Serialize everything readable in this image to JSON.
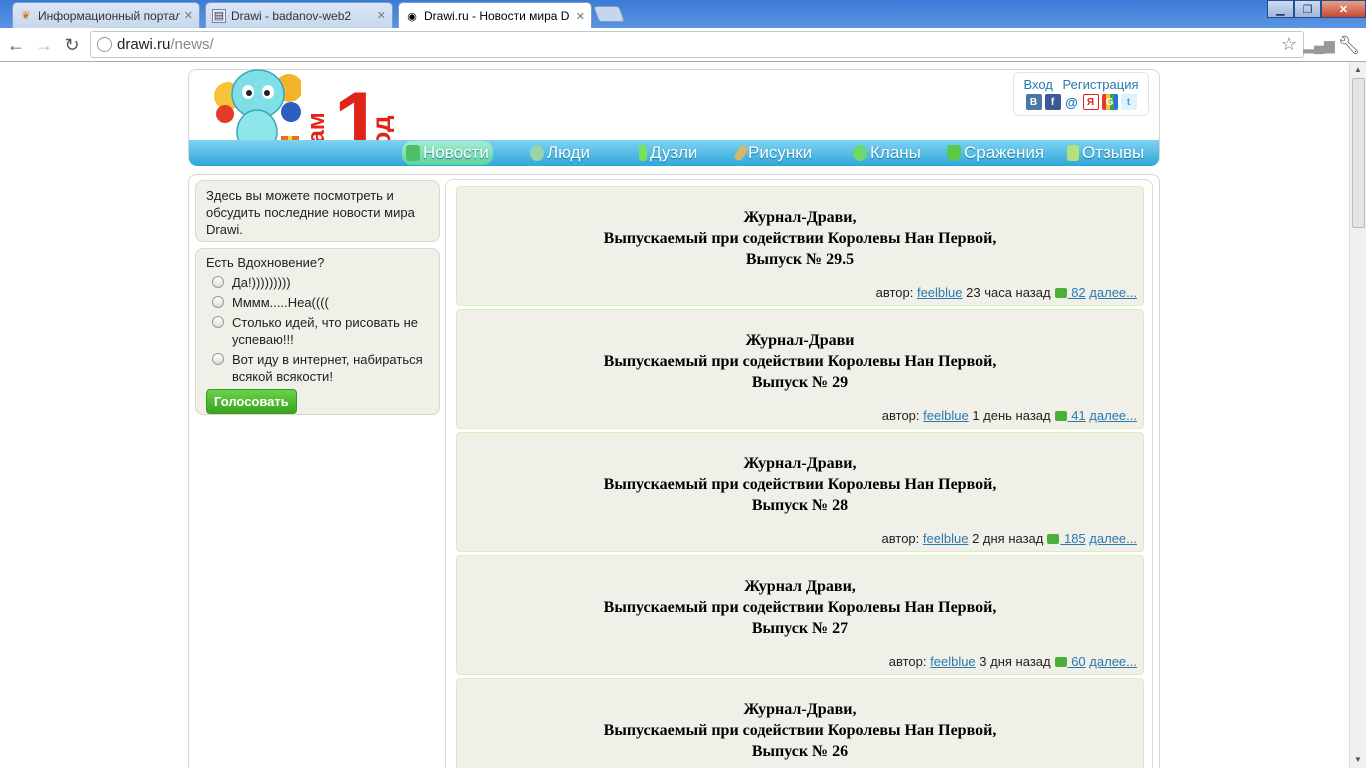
{
  "browser": {
    "tabs": [
      {
        "title": "Информационный портал",
        "favicon": "leaf-icon",
        "active": false
      },
      {
        "title": "Drawi - badanov-web2",
        "favicon": "page-icon",
        "active": false
      },
      {
        "title": "Drawi.ru - Новости мира D",
        "favicon": "eye-icon",
        "active": true
      }
    ],
    "url_host": "drawi.ru",
    "url_path": "/news/"
  },
  "header": {
    "login": "Вход",
    "register": "Регистрация",
    "socials": [
      "В",
      "f",
      "@",
      "Я",
      "G",
      "t"
    ],
    "nav": [
      {
        "label": "Новости",
        "active": true
      },
      {
        "label": "Люди",
        "active": false
      },
      {
        "label": "Дузли",
        "active": false
      },
      {
        "label": "Рисунки",
        "active": false
      },
      {
        "label": "Кланы",
        "active": false
      },
      {
        "label": "Сражения",
        "active": false
      },
      {
        "label": "Отзывы",
        "active": false
      }
    ],
    "logo_text": "нам 1 год"
  },
  "sidebar": {
    "intro": "Здесь вы можете посмотреть и обсудить последние новости мира Drawi.",
    "poll": {
      "question": "Есть Вдохновение?",
      "options": [
        "Да!)))))))))",
        "Мммм.....Неа((((",
        "Столько идей, что рисовать не успеваю!!!",
        "Вот иду в интернет, набираться всякой всякости!"
      ],
      "vote_label": "Голосовать"
    }
  },
  "news": [
    {
      "line1": "Журнал-Драви,",
      "line2": "Выпускаемый при содействии Королевы Нан Первой,",
      "line3": "Выпуск № 29.5",
      "author_label": "автор:",
      "author": "feelblue",
      "time": "23 часа назад",
      "comments": " 82",
      "more": "далее..."
    },
    {
      "line1": "Журнал-Драви",
      "line2": "Выпускаемый при содействии Королевы Нан Первой,",
      "line3": "Выпуск № 29",
      "author_label": "автор:",
      "author": "feelblue",
      "time": "1 день назад",
      "comments": " 41",
      "more": "далее..."
    },
    {
      "line1": "Журнал-Драви,",
      "line2": "Выпускаемый при содействии Королевы Нан Первой,",
      "line3": "Выпуск № 28",
      "author_label": "автор:",
      "author": "feelblue",
      "time": "2 дня назад",
      "comments": " 185",
      "more": "далее..."
    },
    {
      "line1": "Журнал Драви,",
      "line2": "Выпускаемый при содействии Королевы Нан Первой,",
      "line3": "Выпуск № 27",
      "author_label": "автор:",
      "author": "feelblue",
      "time": "3 дня назад",
      "comments": " 60",
      "more": "далее..."
    },
    {
      "line1": "Журнал-Драви,",
      "line2": "Выпускаемый при содействии Королевы Нан Первой,",
      "line3": "Выпуск № 26",
      "author_label": "",
      "author": "",
      "time": "",
      "comments": "",
      "more": ""
    }
  ]
}
